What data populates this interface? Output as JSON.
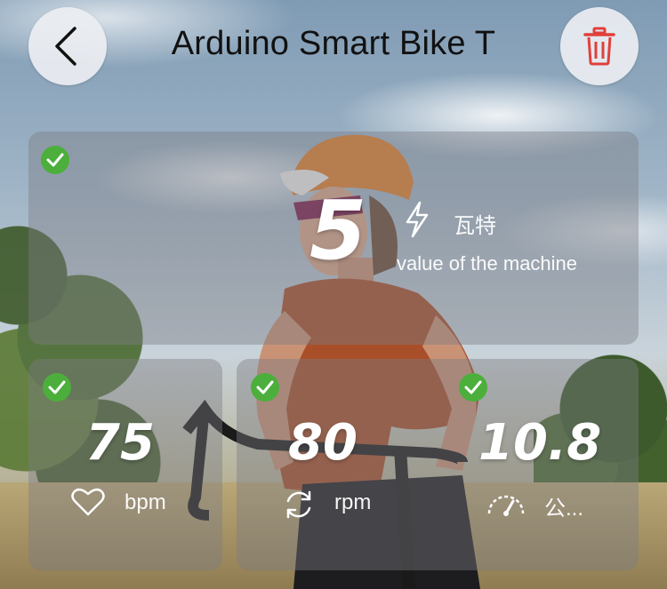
{
  "header": {
    "title": "Arduino Smart Bike T"
  },
  "power": {
    "value": "5",
    "unit": "瓦特",
    "caption": "value of the machine"
  },
  "heart_rate": {
    "value": "75",
    "unit": "bpm"
  },
  "cadence": {
    "value": "80",
    "unit": "rpm"
  },
  "speed": {
    "value": "10.8",
    "unit": "公..."
  },
  "colors": {
    "check_green": "#4caf3c",
    "delete_red": "#e0403a"
  },
  "icons": [
    "chevron-left-icon",
    "trash-icon",
    "check-icon",
    "lightning-icon",
    "heart-icon",
    "refresh-icon",
    "speedometer-icon"
  ]
}
